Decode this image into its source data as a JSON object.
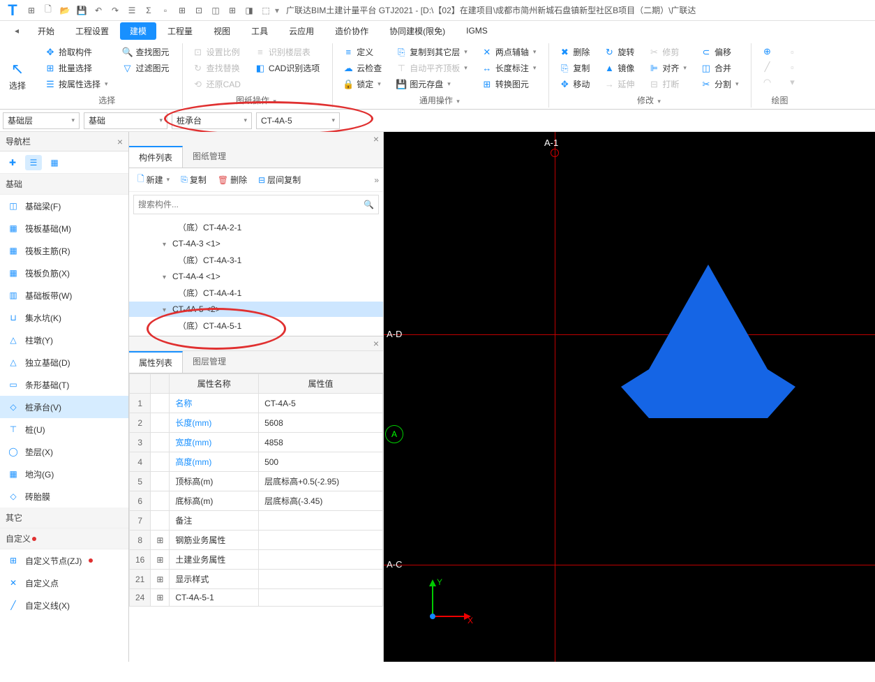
{
  "app": {
    "title": "广联达BIM土建计量平台 GTJ2021 - [D:\\【02】在建项目\\成都市简州新城石盘镇新型社区B项目（二期）\\广联达"
  },
  "menu": {
    "items": [
      "开始",
      "工程设置",
      "建模",
      "工程量",
      "视图",
      "工具",
      "云应用",
      "造价协作",
      "协同建模(限免)",
      "IGMS"
    ],
    "active": 2
  },
  "ribbon": {
    "select_big": "选择",
    "g1": {
      "pick": "拾取构件",
      "find": "查找图元",
      "batch": "批量选择",
      "filter": "过滤图元",
      "byprop": "按属性选择",
      "label": "选择"
    },
    "g2": {
      "setscale": "设置比例",
      "identlayer": "识别楼层表",
      "findrep": "查找替换",
      "cadopt": "CAD识别选项",
      "restore": "还原CAD",
      "label": "图纸操作"
    },
    "g3": {
      "define": "定义",
      "copyto": "复制到其它层",
      "twopoint": "两点辅轴",
      "cloudcheck": "云检查",
      "autoflat": "自动平齐顶板",
      "lendim": "长度标注",
      "lock": "锁定",
      "savecad": "图元存盘",
      "convert": "转换图元",
      "label": "通用操作"
    },
    "g4": {
      "del": "删除",
      "rotate": "旋转",
      "trim": "修剪",
      "offset": "偏移",
      "copy": "复制",
      "mirror": "镜像",
      "align": "对齐",
      "merge": "合并",
      "move": "移动",
      "extend": "延伸",
      "break": "打断",
      "split": "分割",
      "label": "修改"
    },
    "g5": {
      "label": "绘图"
    }
  },
  "selectors": {
    "floor": "基础层",
    "category": "基础",
    "type": "桩承台",
    "component": "CT-4A-5"
  },
  "leftPanel": {
    "title": "导航栏",
    "section1": "基础",
    "items": [
      "基础梁(F)",
      "筏板基础(M)",
      "筏板主筋(R)",
      "筏板负筋(X)",
      "基础板带(W)",
      "集水坑(K)",
      "柱墩(Y)",
      "独立基础(D)",
      "条形基础(T)",
      "桩承台(V)",
      "桩(U)",
      "垫层(X)",
      "地沟(G)",
      "砖胎膜"
    ],
    "selected": 9,
    "section2": "其它",
    "section3": "自定义",
    "customItems": [
      "自定义节点(ZJ)",
      "自定义点",
      "自定义线(X)"
    ]
  },
  "midPanel": {
    "tab1": "构件列表",
    "tab2": "图纸管理",
    "toolbar": {
      "new": "新建",
      "copy": "复制",
      "delete": "删除",
      "floorcopy": "层间复制"
    },
    "searchPlaceholder": "搜索构件...",
    "tree": [
      {
        "label": "（底）CT-4A-2-1",
        "child": true
      },
      {
        "label": "CT-4A-3  <1>",
        "child": false
      },
      {
        "label": "（底）CT-4A-3-1",
        "child": true
      },
      {
        "label": "CT-4A-4  <1>",
        "child": false
      },
      {
        "label": "（底）CT-4A-4-1",
        "child": true
      },
      {
        "label": "CT-4A-5  <2>",
        "child": false,
        "selected": true
      },
      {
        "label": "（底）CT-4A-5-1",
        "child": true
      }
    ]
  },
  "propPanel": {
    "tab1": "属性列表",
    "tab2": "图层管理",
    "header": {
      "name": "属性名称",
      "value": "属性值"
    },
    "rows": [
      {
        "n": "1",
        "name": "名称",
        "value": "CT-4A-5",
        "link": true
      },
      {
        "n": "2",
        "name": "长度(mm)",
        "value": "5608",
        "link": true
      },
      {
        "n": "3",
        "name": "宽度(mm)",
        "value": "4858",
        "link": true
      },
      {
        "n": "4",
        "name": "高度(mm)",
        "value": "500",
        "link": true
      },
      {
        "n": "5",
        "name": "顶标高(m)",
        "value": "层底标高+0.5(-2.95)"
      },
      {
        "n": "6",
        "name": "底标高(m)",
        "value": "层底标高(-3.45)"
      },
      {
        "n": "7",
        "name": "备注",
        "value": ""
      },
      {
        "n": "8",
        "name": "钢筋业务属性",
        "value": "",
        "expand": true
      },
      {
        "n": "16",
        "name": "土建业务属性",
        "value": "",
        "expand": true
      },
      {
        "n": "21",
        "name": "显示样式",
        "value": "",
        "expand": true
      },
      {
        "n": "24",
        "name": "CT-4A-5-1",
        "value": "",
        "expand": true
      }
    ]
  },
  "viewport": {
    "axes": {
      "x": "X",
      "y": "Y"
    },
    "gridLabels": {
      "top": "A-1",
      "mid": "A-D",
      "left": "A",
      "bottom": "A-C"
    }
  }
}
